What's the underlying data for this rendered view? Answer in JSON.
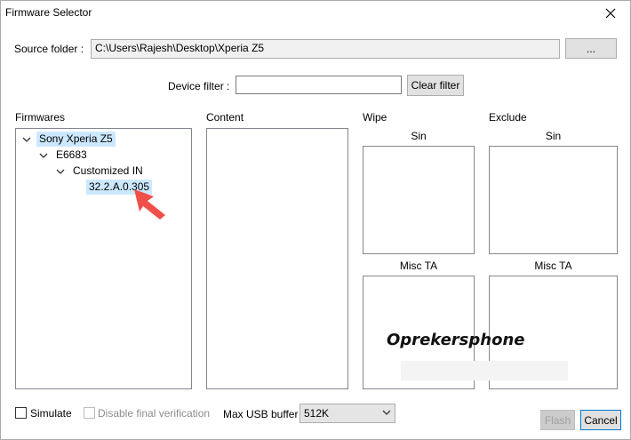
{
  "window": {
    "title": "Firmware Selector"
  },
  "source_folder": {
    "label": "Source folder :",
    "value": "C:\\Users\\Rajesh\\Desktop\\Xperia Z5",
    "browse_label": "..."
  },
  "device_filter": {
    "label": "Device filter :",
    "value": "",
    "clear_label": "Clear filter"
  },
  "firmwares": {
    "label": "Firmwares",
    "tree": {
      "root": "Sony Xperia Z5",
      "model": "E6683",
      "variant": "Customized IN",
      "version": "32.2.A.0.305"
    }
  },
  "content": {
    "label": "Content"
  },
  "wipe": {
    "label": "Wipe",
    "sin_label": "Sin",
    "misc_ta_label": "Misc TA"
  },
  "exclude": {
    "label": "Exclude",
    "sin_label": "Sin",
    "misc_ta_label": "Misc TA"
  },
  "options": {
    "simulate_label": "Simulate",
    "simulate_checked": false,
    "disable_verification_label": "Disable final verification",
    "disable_verification_checked": false
  },
  "usb_buffer": {
    "label": "Max USB buffer",
    "selected": "512K"
  },
  "actions": {
    "flash_label": "Flash",
    "cancel_label": "Cancel"
  },
  "watermark": {
    "text": "Oprekersphone"
  },
  "colors": {
    "selection": "#cce8ff",
    "accent": "#0078d7",
    "pointer": "#f0504a"
  },
  "icons": {
    "close": "close-icon",
    "chevron": "chevron-down-icon",
    "dropdown": "dropdown-arrow-icon",
    "pointer": "arrow-pointer-icon"
  }
}
